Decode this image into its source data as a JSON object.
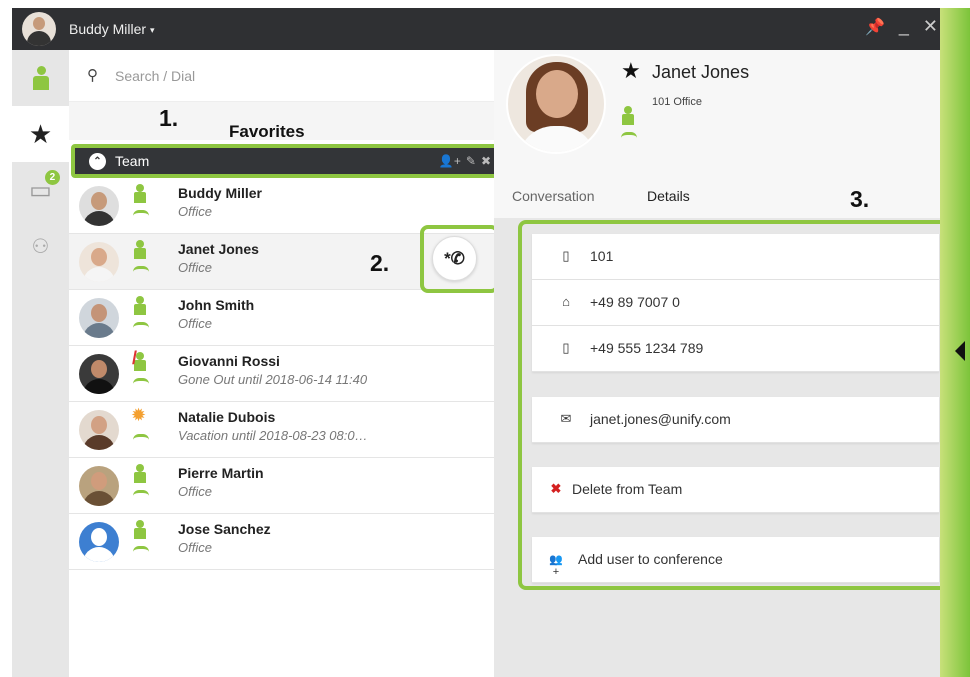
{
  "titlebar": {
    "user": "Buddy Miller",
    "caret": "▾",
    "pin": "📌",
    "minimize": "_",
    "close": "✕"
  },
  "search": {
    "placeholder": "Search / Dial",
    "icon": "search-icon"
  },
  "favorites": {
    "title": "Favorites"
  },
  "annotations": {
    "one": "1.",
    "two": "2.",
    "three": "3."
  },
  "team": {
    "label": "Team",
    "chevron": "⌃",
    "actions": [
      "👤+",
      "✎",
      "✖"
    ]
  },
  "rail": {
    "chat_badge": "2"
  },
  "contacts": [
    {
      "name": "Buddy Miller",
      "status": "Office",
      "presence": "available"
    },
    {
      "name": "Janet Jones",
      "status": "Office",
      "presence": "available"
    },
    {
      "name": "John Smith",
      "status": "Office",
      "presence": "available"
    },
    {
      "name": "Giovanni Rossi",
      "status": "Gone Out until 2018-06-14 11:40",
      "presence": "away"
    },
    {
      "name": "Natalie Dubois",
      "status": "Vacation until 2018-08-23 08:0…",
      "presence": "vacation"
    },
    {
      "name": "Pierre Martin",
      "status": "Office",
      "presence": "available"
    },
    {
      "name": "Jose Sanchez",
      "status": "Office",
      "presence": "available"
    }
  ],
  "call_button": {
    "glyph": "*✆"
  },
  "detail": {
    "name": "Janet Jones",
    "subtitle": "101 Office",
    "tabs": [
      "Conversation",
      "Details"
    ],
    "phones": [
      {
        "icon": "desk-phone-icon",
        "glyph": "▯",
        "value": "101"
      },
      {
        "icon": "home-icon",
        "glyph": "⌂",
        "value": "+49 89 7007 0"
      },
      {
        "icon": "mobile-icon",
        "glyph": "▯",
        "value": "+49 555 1234 789"
      }
    ],
    "email": {
      "glyph": "✉",
      "value": "janet.jones@unify.com"
    },
    "delete": {
      "glyph": "✖",
      "label": "Delete from Team"
    },
    "conference": {
      "glyph": "👥+",
      "label": "Add user to conference"
    }
  },
  "colors": {
    "accent": "#8ec641",
    "titlebar": "#2f3033",
    "delete": "#d42020"
  }
}
